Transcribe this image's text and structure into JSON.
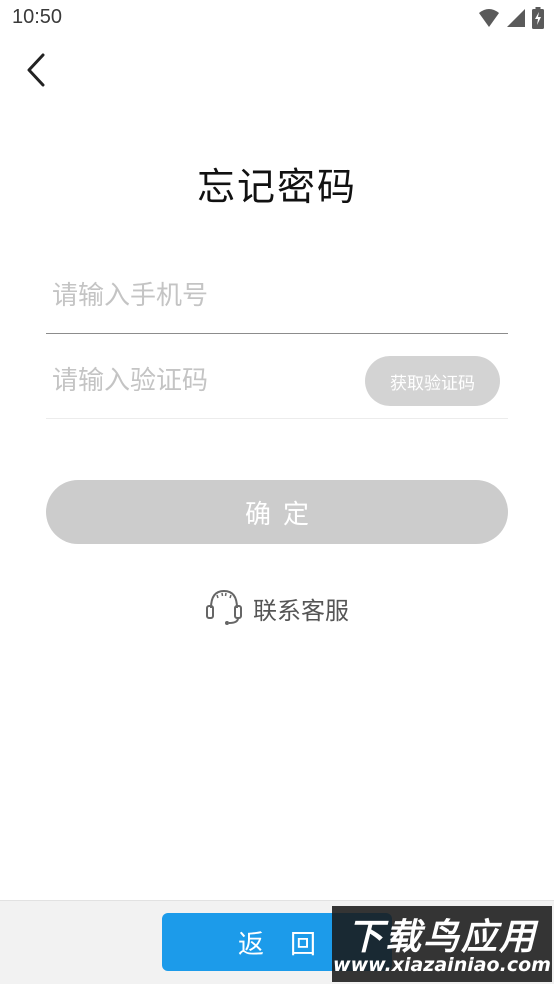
{
  "status_bar": {
    "time": "10:50",
    "icons": [
      "wifi-icon",
      "signal-icon",
      "battery-charging-icon"
    ]
  },
  "header": {
    "back_icon": "chevron-left-icon",
    "title": "忘记密码"
  },
  "form": {
    "phone_placeholder": "请输入手机号",
    "phone_value": "",
    "code_placeholder": "请输入验证码",
    "code_value": "",
    "get_code_label": "获取验证码",
    "confirm_label": "确定"
  },
  "support": {
    "icon": "headset-icon",
    "label": "联系客服"
  },
  "bottom": {
    "return_label": "返回"
  },
  "watermark": {
    "main": "下载鸟应用",
    "sub": "www.xiazainiao.com"
  },
  "colors": {
    "accent": "#1c9bea",
    "disabled_button": "#cccccc",
    "code_button": "#d3d3d3",
    "placeholder": "#c4c4c4"
  }
}
